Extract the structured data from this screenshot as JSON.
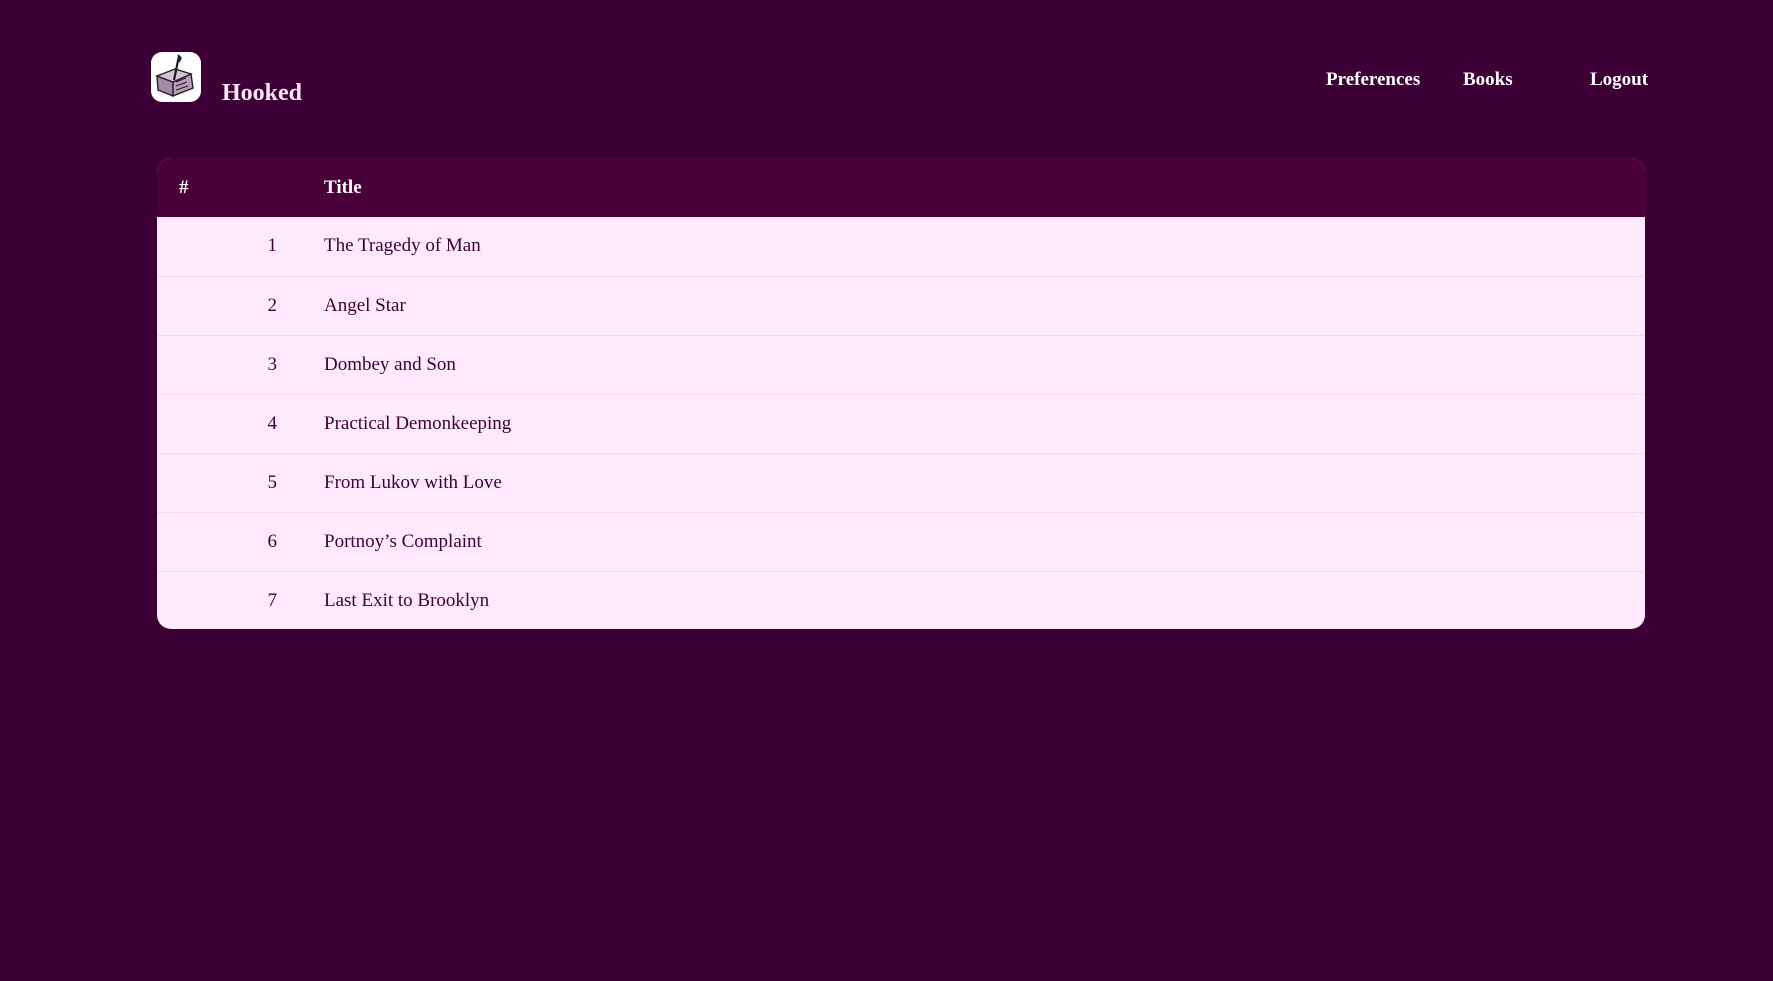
{
  "app": {
    "name": "Hooked",
    "logo_icon": "book-with-arrow-icon"
  },
  "nav": {
    "preferences": "Preferences",
    "books": "Books",
    "logout": "Logout"
  },
  "table": {
    "headers": {
      "number": "#",
      "title": "Title"
    },
    "rows": [
      {
        "number": "1",
        "title": "The Tragedy of Man"
      },
      {
        "number": "2",
        "title": "Angel Star"
      },
      {
        "number": "3",
        "title": "Dombey and Son"
      },
      {
        "number": "4",
        "title": "Practical Demonkeeping"
      },
      {
        "number": "5",
        "title": "From Lukov with Love"
      },
      {
        "number": "6",
        "title": "Portnoy’s Complaint"
      },
      {
        "number": "7",
        "title": "Last Exit to Brooklyn"
      }
    ]
  },
  "colors": {
    "page_background": "#3c0036",
    "table_header": "#4a0039",
    "table_body": "#ffeafd",
    "row_text": "#3c0036"
  }
}
